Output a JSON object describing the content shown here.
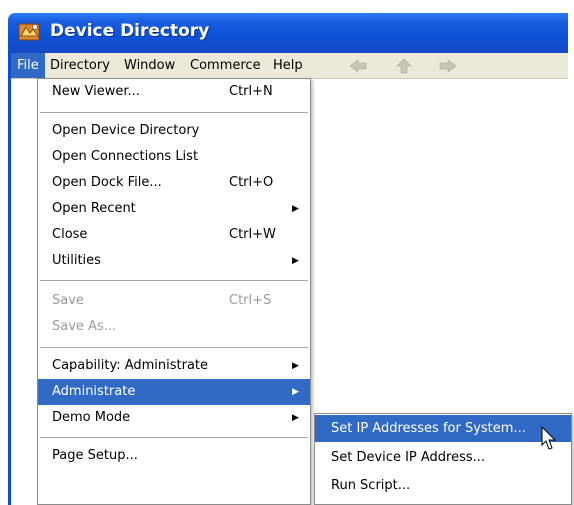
{
  "window": {
    "title": "Device Directory",
    "icon": "device-directory-app-icon"
  },
  "menubar": {
    "items": [
      {
        "label": "File",
        "active": true
      },
      {
        "label": "Directory",
        "active": false
      },
      {
        "label": "Window",
        "active": false
      },
      {
        "label": "Commerce",
        "active": false
      },
      {
        "label": "Help",
        "active": false
      }
    ],
    "nav_icons": [
      "back-arrow-icon",
      "up-arrow-icon",
      "forward-arrow-icon"
    ]
  },
  "file_menu": {
    "items": [
      {
        "label": "New Viewer...",
        "shortcut": "Ctrl+N"
      },
      {
        "label": "Open Device Directory"
      },
      {
        "label": "Open Connections List"
      },
      {
        "label": "Open Dock File...",
        "shortcut": "Ctrl+O"
      },
      {
        "label": "Open Recent",
        "submenu": true
      },
      {
        "label": "Close",
        "shortcut": "Ctrl+W"
      },
      {
        "label": "Utilities",
        "submenu": true
      },
      {
        "label": "Save",
        "shortcut": "Ctrl+S",
        "disabled": true
      },
      {
        "label": "Save As...",
        "disabled": true
      },
      {
        "label": "Capability: Administrate",
        "submenu": true
      },
      {
        "label": "Administrate",
        "submenu": true,
        "highlighted": true
      },
      {
        "label": "Demo Mode",
        "submenu": true
      },
      {
        "label": "Page Setup..."
      }
    ]
  },
  "administrate_submenu": {
    "items": [
      {
        "label": "Set IP Addresses for System...",
        "highlighted": true
      },
      {
        "label": "Set Device IP Address..."
      },
      {
        "label": "Run Script..."
      }
    ]
  },
  "colors": {
    "titlebar": "#0d52d6",
    "highlight": "#316ac5",
    "menubar": "#ece9d8",
    "disabled_text": "#9a9a9a"
  }
}
